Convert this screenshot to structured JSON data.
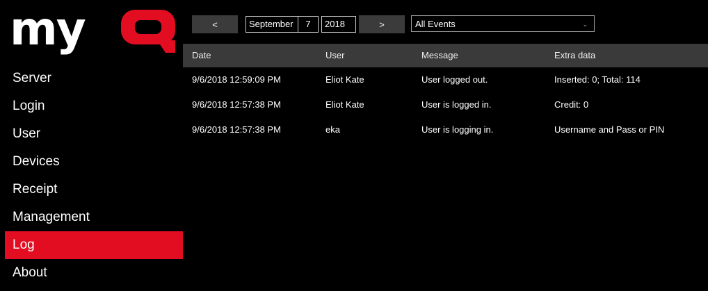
{
  "app": {
    "logo_text": "myQ",
    "brand_color": "#e30d21"
  },
  "sidebar": {
    "items": [
      {
        "label": "Server",
        "active": false
      },
      {
        "label": "Login",
        "active": false
      },
      {
        "label": "User",
        "active": false
      },
      {
        "label": "Devices",
        "active": false
      },
      {
        "label": "Receipt",
        "active": false
      },
      {
        "label": "Management",
        "active": false
      },
      {
        "label": "Log",
        "active": true
      },
      {
        "label": "About",
        "active": false
      }
    ]
  },
  "toolbar": {
    "prev_label": "<",
    "next_label": ">",
    "date": {
      "month": "September",
      "day": "7",
      "year": "2018"
    },
    "filter": {
      "selected": "All Events",
      "icon": "chevron-down-icon"
    }
  },
  "table": {
    "columns": [
      "Date",
      "User",
      "Message",
      "Extra data"
    ],
    "rows": [
      [
        "9/6/2018 12:59:09 PM",
        "Eliot Kate",
        "User logged out.",
        "Inserted: 0; Total: 114"
      ],
      [
        "9/6/2018 12:57:38 PM",
        "Eliot Kate",
        "User is logged in.",
        "Credit: 0"
      ],
      [
        "9/6/2018 12:57:38 PM",
        "eka",
        "User is logging in.",
        "Username and Pass or PIN"
      ]
    ]
  }
}
